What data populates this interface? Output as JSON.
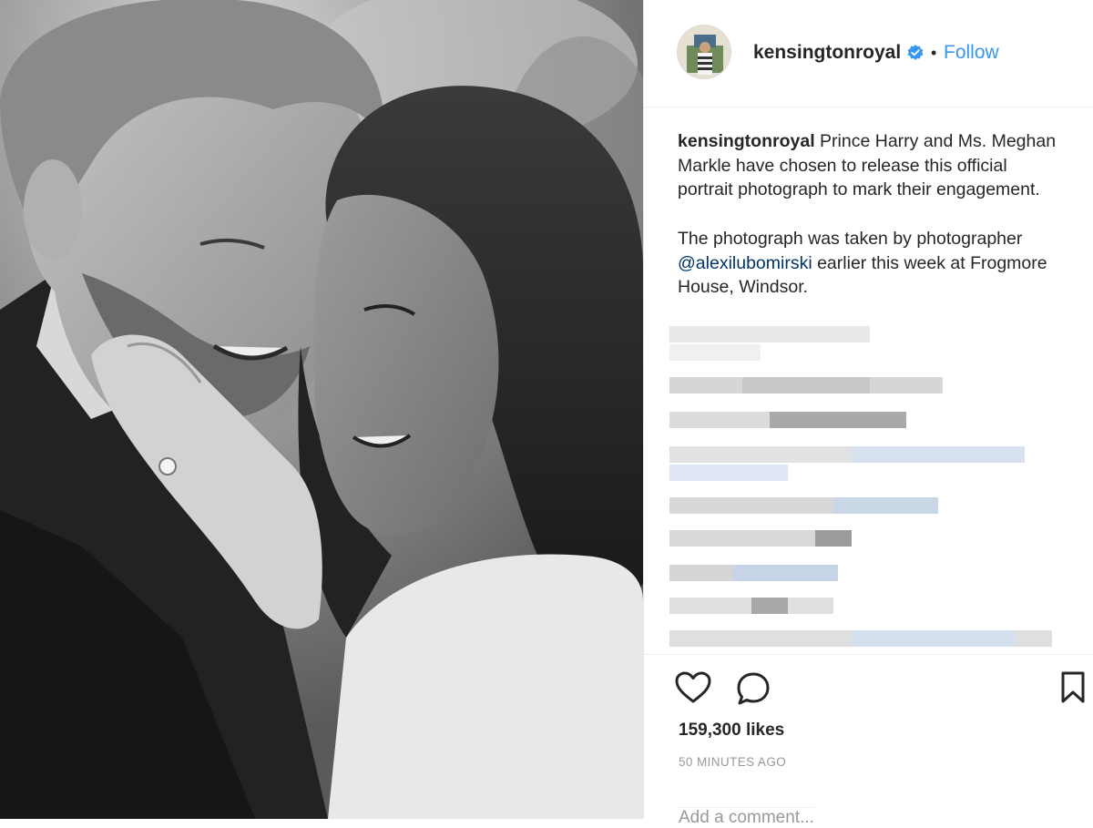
{
  "post": {
    "image_alt": "Black and white engagement portrait",
    "author": "kensingtonroyal",
    "follow_label": "Follow",
    "separator": "•",
    "verified_icon": "verified-badge-icon"
  },
  "caption": {
    "username": "kensingtonroyal",
    "line1": " Prince Harry and Ms. Meghan Markle have chosen to release this official portrait photograph to mark their engagement.",
    "line2_a": "The photograph was taken by photographer ",
    "mention": "@alexilubomirski",
    "line2_b": " earlier this week at Frogmore House, Windsor."
  },
  "actions": {
    "like_icon": "heart-icon",
    "comment_icon": "comment-icon",
    "save_icon": "bookmark-icon",
    "likes": "159,300 likes",
    "timestamp": "50 MINUTES AGO",
    "comment_placeholder": "Add a comment..."
  },
  "colors": {
    "link": "#3897f0",
    "text": "#262626",
    "muted": "#999999",
    "verified": "#3897f0"
  }
}
